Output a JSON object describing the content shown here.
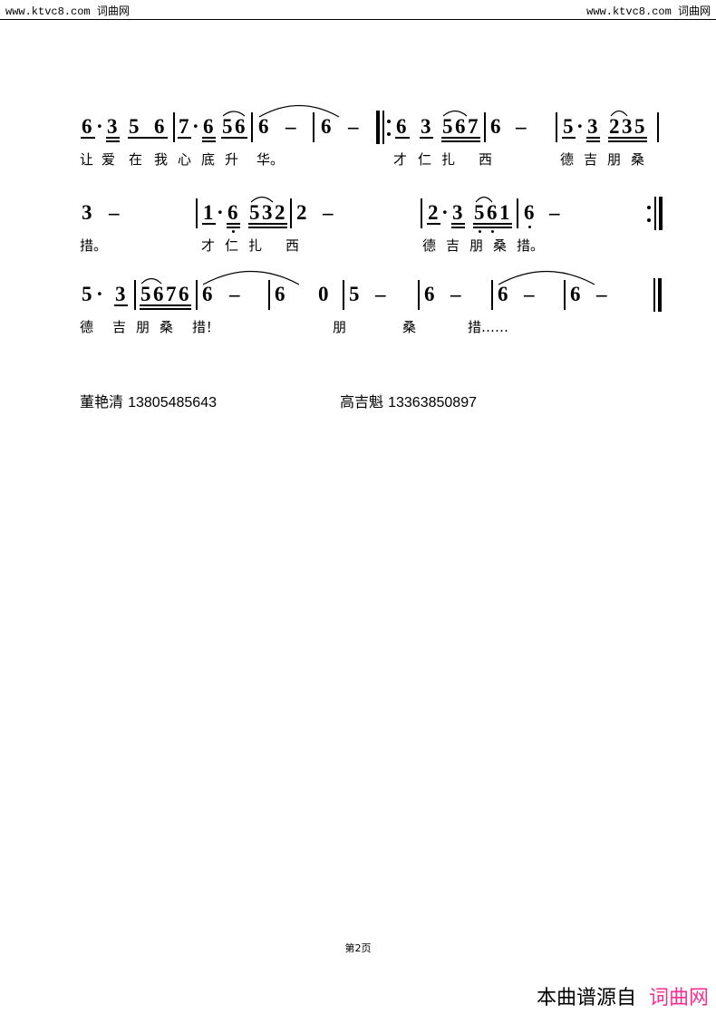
{
  "watermark": {
    "left_url": "www.ktvc8.com",
    "left_cn": "词曲网",
    "right_url": "www.ktvc8.com",
    "right_cn": "词曲网"
  },
  "score": {
    "rows": [
      {
        "id": "row-1",
        "notes": [
          "6",
          "·",
          "3",
          "5",
          "6",
          "7",
          "·",
          "6",
          "5",
          "6",
          "6",
          "–",
          "6",
          "–",
          "6",
          "3",
          "5",
          "6",
          "7",
          "6",
          "–",
          "5",
          "·",
          "3",
          "2",
          "3",
          "5"
        ],
        "lyrics": [
          "让",
          "爱",
          "在",
          "我",
          "心",
          "底",
          "升",
          "华。",
          "才",
          "仁",
          "扎",
          "西",
          "德",
          "吉",
          "朋",
          "桑"
        ]
      },
      {
        "id": "row-2",
        "notes": [
          "3",
          "–",
          "1",
          "·",
          "6",
          "5",
          "3",
          "2",
          "2",
          "–",
          "2",
          "·",
          "3",
          "5",
          "6",
          "1",
          "6",
          "–"
        ],
        "lyrics": [
          "措。",
          "才",
          "仁",
          "扎",
          "西",
          "德",
          "吉",
          "朋",
          "桑",
          "措。"
        ]
      },
      {
        "id": "row-3",
        "notes": [
          "5",
          "·",
          "3",
          "5",
          "6",
          "7",
          "6",
          "6",
          "–",
          "6",
          "0",
          "5",
          "–",
          "6",
          "–",
          "6",
          "–",
          "6",
          "–"
        ],
        "lyrics": [
          "德",
          "吉",
          "朋",
          "桑",
          "措！",
          "朋",
          "桑",
          "措……"
        ]
      }
    ]
  },
  "credits": {
    "left_name": "董艳清",
    "left_phone": "13805485643",
    "right_name": "高吉魁",
    "right_phone": "13363850897"
  },
  "footer": {
    "page_label": "第2页",
    "source_prefix": "本曲谱源自",
    "source_brand": "词曲网",
    "brand_color": "#fb2e8f"
  }
}
